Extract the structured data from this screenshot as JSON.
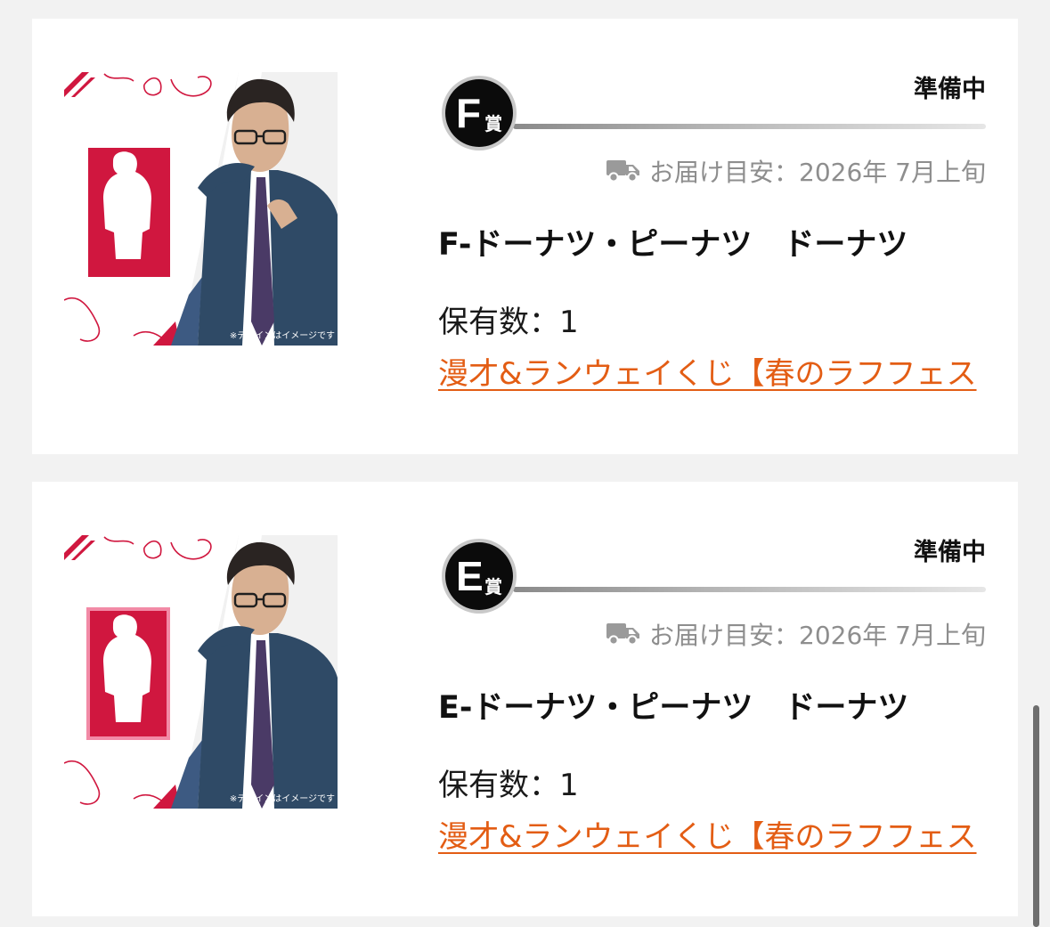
{
  "colors": {
    "link": "#e35d14",
    "status_text": "#111111",
    "muted_text": "#8e8e8e",
    "badge_bg": "#0b0b0b",
    "card_bg": "#ffffff",
    "page_bg": "#f2f2f2",
    "thumbnail_accent": "#d0173f"
  },
  "items": [
    {
      "grade_letter": "F",
      "grade_suffix": "賞",
      "status": "準備中",
      "delivery_icon": "truck-icon",
      "delivery": "お届け目安：2026年 7月上旬",
      "name": "F-ドーナツ・ピーナツ　ドーナツ",
      "owned": "保有数：1",
      "campaign": "漫才&ランウェイくじ【春のラフフェス",
      "image_caption": "※デザインはイメージです"
    },
    {
      "grade_letter": "E",
      "grade_suffix": "賞",
      "status": "準備中",
      "delivery_icon": "truck-icon",
      "delivery": "お届け目安：2026年 7月上旬",
      "name": "E-ドーナツ・ピーナツ　ドーナツ",
      "owned": "保有数：1",
      "campaign": "漫才&ランウェイくじ【春のラフフェス",
      "image_caption": "※デザインはイメージです"
    }
  ]
}
